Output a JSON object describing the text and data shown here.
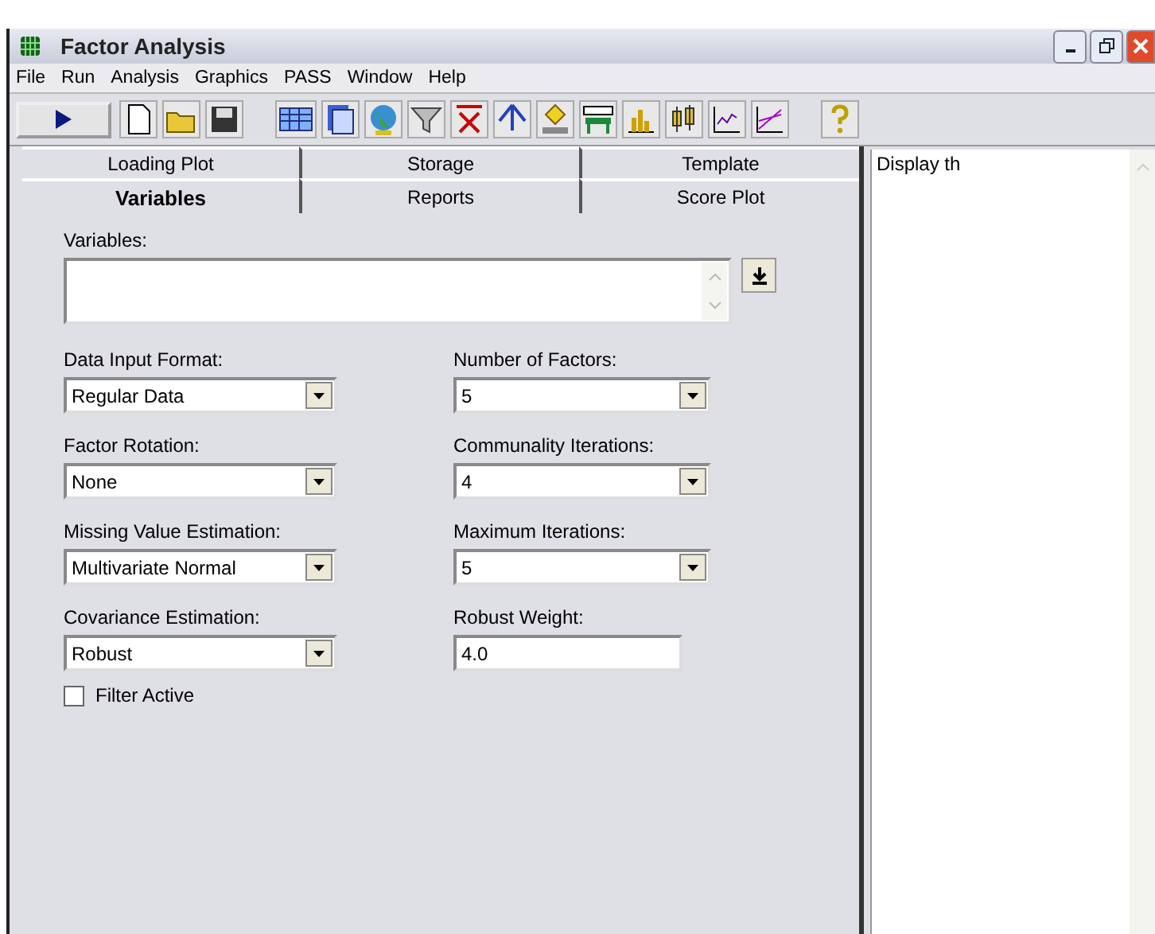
{
  "window": {
    "title": "Factor Analysis"
  },
  "menu": [
    "File",
    "Run",
    "Analysis",
    "Graphics",
    "PASS",
    "Window",
    "Help"
  ],
  "tab_rows": [
    [
      {
        "label": "Loading Plot",
        "selected": false
      },
      {
        "label": "Storage",
        "selected": false
      },
      {
        "label": "Template",
        "selected": false
      }
    ],
    [
      {
        "label": "Variables",
        "selected": true
      },
      {
        "label": "Reports",
        "selected": false
      },
      {
        "label": "Score Plot",
        "selected": false
      }
    ]
  ],
  "variables": {
    "label": "Variables:"
  },
  "fields": [
    {
      "label": "Data Input Format:",
      "value": "Regular Data",
      "kind": "dropdown"
    },
    {
      "label": "Number of Factors:",
      "value": "5",
      "kind": "dropdown"
    },
    {
      "label": "Factor Rotation:",
      "value": "None",
      "kind": "dropdown"
    },
    {
      "label": "Communality Iterations:",
      "value": "4",
      "kind": "dropdown"
    },
    {
      "label": "Missing Value Estimation:",
      "value": "Multivariate Normal",
      "kind": "dropdown"
    },
    {
      "label": "Maximum Iterations:",
      "value": "5",
      "kind": "dropdown"
    },
    {
      "label": "Covariance Estimation:",
      "value": "Robust",
      "kind": "dropdown"
    },
    {
      "label": "Robust Weight:",
      "value": "4.0",
      "kind": "text"
    }
  ],
  "filter": {
    "label": "Filter Active",
    "checked": false
  },
  "help_panel": {
    "text": "Display th"
  }
}
